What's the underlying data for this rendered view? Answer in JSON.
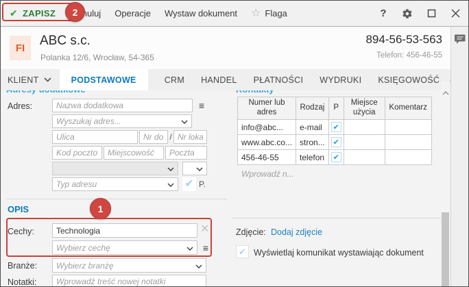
{
  "colors": {
    "save_green": "#2e7d32",
    "annotation_red": "#cf4740",
    "accent_blue": "#0b7ac1",
    "section_blue": "#38a6da",
    "link_blue": "#1b7fc4",
    "check_blue": "#1b9de8",
    "badge_orange": "#dd5f2b"
  },
  "toolbar": {
    "save": "ZAPISZ",
    "cancel": "Anuluj",
    "operations": "Operacje",
    "issue_document": "Wystaw dokument",
    "flag": "Flaga",
    "help": "?"
  },
  "header": {
    "badge": "FI",
    "company_name": "ABC s.c.",
    "company_address": "Polanka 12/6, Wrocław, 54-365",
    "tax_id": "894-56-53-563",
    "phone": "Telefon: 456-46-55"
  },
  "tabs": [
    {
      "label": "KLIENT"
    },
    {
      "label": "PODSTAWOWE"
    },
    {
      "label": "CRM"
    },
    {
      "label": "HANDEL"
    },
    {
      "label": "PŁATNOŚCI"
    },
    {
      "label": "WYDRUKI"
    },
    {
      "label": "KSIĘGOWOŚĆ"
    }
  ],
  "addresses_section": {
    "title": "Adresy dodatkowe",
    "address_label": "Adres:",
    "name_placeholder": "Nazwa dodatkowa",
    "search_placeholder": "Wyszukaj adres...",
    "street_placeholder": "Ulica",
    "house_placeholder": "Nr domu",
    "separator": "/",
    "unit_placeholder": "Nr lokalu",
    "zip_placeholder": "Kod pocztowy",
    "city_placeholder": "Miejscowość",
    "post_placeholder": "Poczta",
    "type_placeholder": "Typ adresu",
    "primary_label": "P."
  },
  "contacts_section": {
    "title": "Kontakty",
    "headers": [
      "Numer lub adres",
      "Rodzaj",
      "P",
      "Miejsce użycia",
      "Komentarz"
    ],
    "rows": [
      {
        "value": "info@abc...",
        "kind": "e-mail",
        "checked": true
      },
      {
        "value": "www.abc.co...",
        "kind": "stron...",
        "checked": true
      },
      {
        "value": "456-46-55",
        "kind": "telefon",
        "checked": true
      }
    ],
    "new_placeholder": "Wprowadź n..."
  },
  "opis_section": {
    "title": "OPIS",
    "features_label": "Cechy:",
    "feature_value": "Technologia",
    "feature_placeholder": "Wybierz cechę",
    "industry_label": "Branże:",
    "industry_placeholder": "Wybierz branżę",
    "notes_label": "Notatki:",
    "notes_placeholder": "Wprowadź treść nowej notatki"
  },
  "photo": {
    "label": "Zdjęcie:",
    "link": "Dodaj zdjęcie"
  },
  "message_option": {
    "label": "Wyświetlaj komunikat wystawiając dokument"
  },
  "annotations": {
    "step_1": "1",
    "step_2": "2"
  }
}
